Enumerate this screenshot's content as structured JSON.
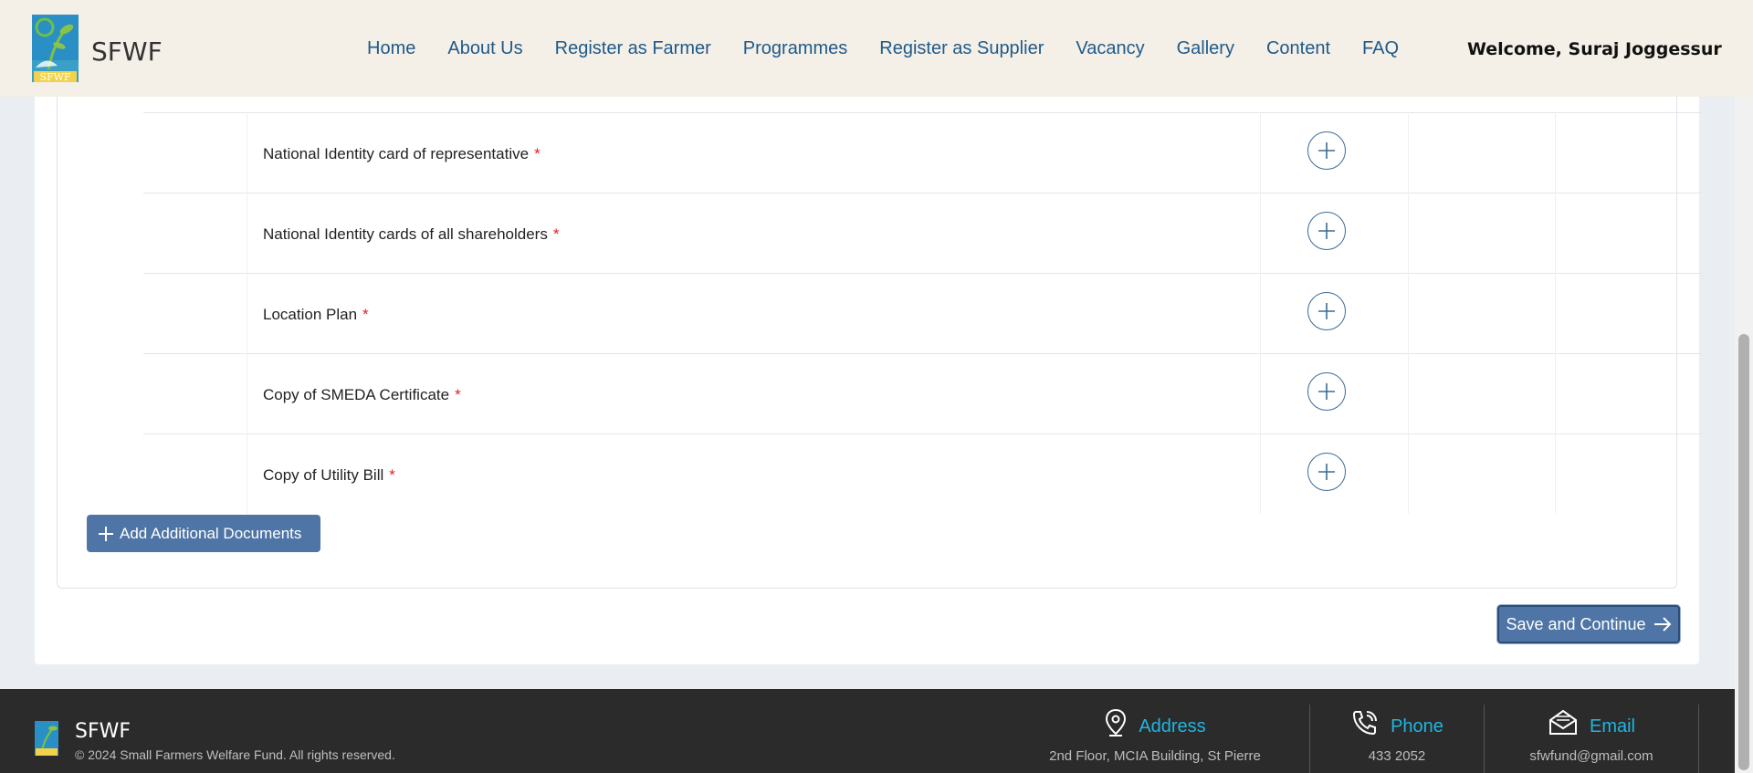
{
  "brand": {
    "name": "SFWF"
  },
  "nav": {
    "items": [
      {
        "label": "Home"
      },
      {
        "label": "About Us"
      },
      {
        "label": "Register as Farmer"
      },
      {
        "label": "Programmes"
      },
      {
        "label": "Register as Supplier"
      },
      {
        "label": "Vacancy"
      },
      {
        "label": "Gallery"
      },
      {
        "label": "Content"
      },
      {
        "label": "FAQ"
      }
    ],
    "welcome": "Welcome, Suraj Joggessur"
  },
  "documents": [
    {
      "label": "National Identity card of representative",
      "required": "*"
    },
    {
      "label": "National Identity cards of all shareholders",
      "required": "*"
    },
    {
      "label": "Location Plan",
      "required": "*"
    },
    {
      "label": "Copy of SMEDA Certificate",
      "required": "*"
    },
    {
      "label": "Copy of Utility Bill",
      "required": "*"
    }
  ],
  "actions": {
    "add_documents": "Add Additional Documents",
    "save_continue": "Save and Continue"
  },
  "footer": {
    "brand": "SFWF",
    "copyright": "© 2024 Small Farmers Welfare Fund. All rights reserved.",
    "address": {
      "title": "Address",
      "value": "2nd Floor, MCIA Building, St Pierre"
    },
    "phone": {
      "title": "Phone",
      "value": "433 2052"
    },
    "email": {
      "title": "Email",
      "value": "sfwfund@gmail.com"
    }
  },
  "colors": {
    "header_bg": "#f4efe7",
    "nav_link": "#1f5a8a",
    "primary_button": "#4f75a6",
    "required_mark": "#e02020",
    "footer_bg": "#2b2b2b",
    "footer_accent": "#1fb6e0"
  }
}
